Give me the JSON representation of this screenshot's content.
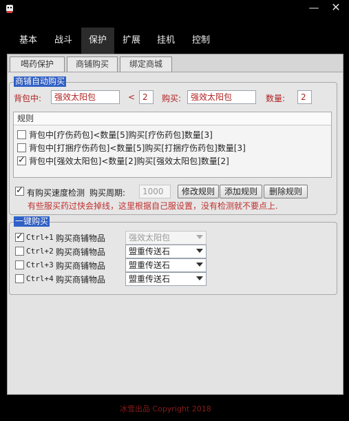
{
  "window": {
    "minimize_icon": "minimize-icon",
    "close_icon": "close-icon",
    "app_icon": "app-icon"
  },
  "nav": {
    "tabs": [
      "基本",
      "战斗",
      "保护",
      "扩展",
      "挂机",
      "控制"
    ],
    "active": "保护"
  },
  "subtabs": [
    "喝药保护",
    "商铺购买",
    "绑定商城"
  ],
  "auto_buy": {
    "group_title": "商铺自动购买",
    "bag_label": "背包中:",
    "bag_item": "强效太阳包",
    "lt_symbol": "<",
    "threshold": "2",
    "buy_label": "购买:",
    "buy_item": "强效太阳包",
    "qty_label": "数量:",
    "qty": "2",
    "rules_header": "规则",
    "rules": [
      {
        "text": "背包中[疗伤药包]<数量[5]购买[疗伤药包]数量[3]",
        "checked": false
      },
      {
        "text": "背包中[打捆疗伤药包]<数量[5]购买[打捆疗伤药包]数量[3]",
        "checked": false
      },
      {
        "text": "背包中[强效太阳包]<数量[2]购买[强效太阳包]数量[2]",
        "checked": true
      }
    ],
    "speed_check_label": "有购买速度检测",
    "speed_check_checked": true,
    "cycle_label": "购买周期:",
    "cycle_value": "1000",
    "modify_button": "修改规则",
    "add_button": "添加规则",
    "delete_button": "删除规则",
    "warning": "有些服买药过快会掉线，这里根据自己服设置，没有检测就不要点上."
  },
  "one_key": {
    "group_title": "一键购买",
    "rows": [
      {
        "hotkey": "Ctrl+1",
        "label": "购买商铺物品",
        "item": "强效太阳包",
        "checked": true,
        "disabled": true
      },
      {
        "hotkey": "Ctrl+2",
        "label": "购买商铺物品",
        "item": "盟重传送石",
        "checked": false,
        "disabled": false
      },
      {
        "hotkey": "Ctrl+3",
        "label": "购买商铺物品",
        "item": "盟重传送石",
        "checked": false,
        "disabled": false
      },
      {
        "hotkey": "Ctrl+4",
        "label": "购买商铺物品",
        "item": "盟重传送石",
        "checked": false,
        "disabled": false
      }
    ]
  },
  "footer": {
    "text": "冰雪出品    Copyright 2018"
  }
}
